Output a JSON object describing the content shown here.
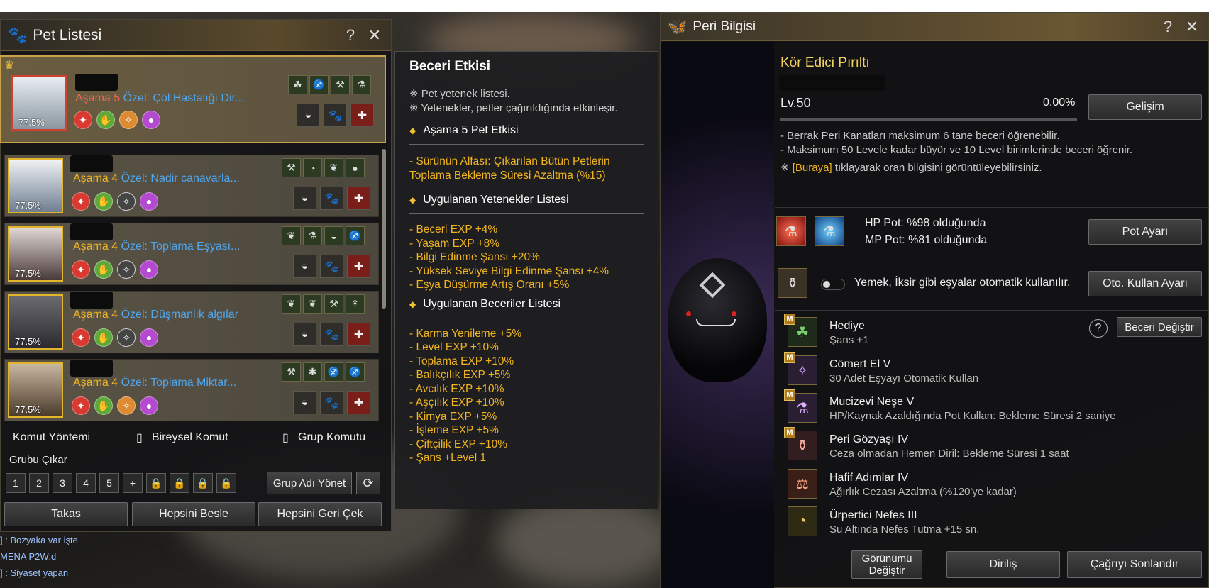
{
  "pet_list": {
    "title": "Pet Listesi",
    "help": "?",
    "close": "✕",
    "pets": [
      {
        "stage_word": "Aşama",
        "stage": "5",
        "special": "Özel: Çöl Hastalığı Dir...",
        "pct": "77.5%",
        "skills": [
          "☘",
          "♐",
          "⚒",
          "⚗"
        ]
      },
      {
        "stage_word": "Aşama",
        "stage": "4",
        "special": "Özel: Nadir canavarla...",
        "pct": "77.5%",
        "skills": [
          "⚒",
          "◔",
          "❦",
          "●"
        ]
      },
      {
        "stage_word": "Aşama",
        "stage": "4",
        "special": "Özel: Toplama Eşyası...",
        "pct": "77.5%",
        "skills": [
          "❦",
          "⚗",
          "◒",
          "♐"
        ]
      },
      {
        "stage_word": "Aşama",
        "stage": "4",
        "special": "Özel: Düşmanlık algılar",
        "pct": "77.5%",
        "skills": [
          "❦",
          "❦",
          "⚒",
          "↟"
        ]
      },
      {
        "stage_word": "Aşama",
        "stage": "4",
        "special": "Özel: Toplama Miktar...",
        "pct": "77.5%",
        "skills": [
          "⚒",
          "✱",
          "♐",
          "♐"
        ]
      }
    ],
    "cmd_method": "Komut Yöntemi",
    "individual_cmd": "Bireysel Komut",
    "group_cmd": "Grup Komutu",
    "remove_group": "Grubu Çıkar",
    "groups": [
      "1",
      "2",
      "3",
      "4",
      "5"
    ],
    "group_name_btn": "Grup Adı Yönet",
    "trade": "Takas",
    "feed_all": "Hepsini Besle",
    "recall_all": "Hepsini Geri Çek"
  },
  "chat": [
    "] : Bozyaka var işte",
    "MENA P2W:d",
    "] : Siyaset yapan"
  ],
  "tooltip": {
    "title": "Beceri Etkisi",
    "notes": [
      "※ Pet yetenek listesi.",
      "※ Yetenekler, petler çağırıldığında etkinleşir."
    ],
    "sec1": "Aşama 5 Pet Etkisi",
    "sec1_lines": [
      "- Sürünün Alfası: Çıkarılan Bütün Petlerin",
      "Toplama Bekleme Süresi Azaltma (%15)"
    ],
    "sec2": "Uygulanan Yetenekler Listesi",
    "sec2_lines": [
      "- Beceri EXP +4%",
      "- Yaşam EXP +8%",
      "- Bilgi Edinme Şansı +20%",
      "- Yüksek Seviye Bilgi Edinme Şansı +4%",
      "- Eşya Düşürme Artış Oranı +5%"
    ],
    "sec3": "Uygulanan Beceriler Listesi",
    "sec3_lines": [
      "- Karma Yenileme +5%",
      "- Level EXP +10%",
      "- Toplama EXP +10%",
      "- Balıkçılık EXP +5%",
      "- Avcılık EXP +10%",
      "- Aşçılık EXP +10%",
      "- Kimya EXP +5%",
      "- İşleme EXP +5%",
      "- Çiftçilik EXP +10%",
      "- Şans +Level 1"
    ]
  },
  "fairy": {
    "title": "Peri Bilgisi",
    "help": "?",
    "close": "✕",
    "name": "Kör Edici Pırıltı",
    "level": "Lv.50",
    "exp": "0.00%",
    "grow_btn": "Gelişim",
    "info": [
      "- Berrak Peri Kanatları maksimum 6 tane beceri öğrenebilir.",
      "- Maksimum 50 Levele kadar büyür ve 10 Level birimlerinde beceri öğrenir."
    ],
    "info_link_prefix": "※",
    "info_link": "[Buraya]",
    "info_link_suffix": "tıklayarak oran bilgisini görüntüleyebilirsiniz.",
    "hp_pot": "HP Pot: %98 olduğunda",
    "mp_pot": "MP Pot: %81 olduğunda",
    "pot_btn": "Pot Ayarı",
    "auto_text": "Yemek, İksir gibi eşyalar otomatik kullanılır.",
    "auto_btn": "Oto. Kullan Ayarı",
    "change_skill_btn": "Beceri Değiştir",
    "skills": [
      {
        "name": "Hediye",
        "desc": "Şans +1",
        "badge": "M",
        "icon": "☘"
      },
      {
        "name": "Cömert El V",
        "desc": "30 Adet Eşyayı Otomatik Kullan",
        "badge": "M",
        "icon": "✧"
      },
      {
        "name": "Mucizevi Neşe V",
        "desc": "HP/Kaynak Azaldığında Pot Kullan: Bekleme Süresi 2 saniye",
        "badge": "M",
        "icon": "⚗"
      },
      {
        "name": "Peri Gözyaşı IV",
        "desc": "Ceza olmadan Hemen Diril: Bekleme Süresi 1 saat",
        "badge": "M",
        "icon": "⚱"
      },
      {
        "name": "Hafif Adımlar IV",
        "desc": "Ağırlık Cezası Azaltma (%120'ye kadar)",
        "badge": "",
        "icon": "⚖"
      },
      {
        "name": "Ürpertici Nefes III",
        "desc": "Su Altında Nefes Tutma +15 sn.",
        "badge": "",
        "icon": "◔"
      }
    ],
    "appearance_btn_1": "Görünümü",
    "appearance_btn_2": "Değiştir",
    "revive_btn": "Diriliş",
    "end_summon_btn": "Çağrıyı Sonlandır"
  }
}
